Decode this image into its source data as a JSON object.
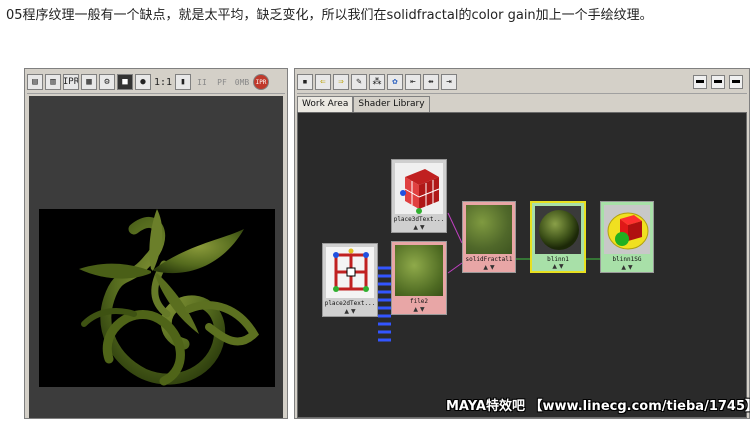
{
  "caption": "05程序纹理一般有一个缺点，就是太平均，缺乏变化，所以我们在solidfractal的color gain加上一个手绘纹理。",
  "render_view": {
    "toolbar": {
      "ratio_label": "1:1",
      "ipr_label": "IPR",
      "ipr_short": "IPR",
      "omb_label": "0MB",
      "pause_label": "II"
    }
  },
  "hypershade": {
    "tabs": [
      "Work Area",
      "Shader Library"
    ],
    "nodes": {
      "place3d": "place3dText...",
      "place2d": "place2dText...",
      "file": "file2",
      "solid": "solidFractal1",
      "blinn": "blinn1",
      "blinnsg": "blinn1SG"
    },
    "node_arrows": "▲ ▼"
  },
  "watermark": "MAYA特效吧 【www.linecg.com/tieba/1745】",
  "colors": {
    "accent_pink": "#e8a6a6",
    "accent_green": "#a8e0a8",
    "selection": "#e8e020",
    "connection_blue": "#3355ff"
  }
}
